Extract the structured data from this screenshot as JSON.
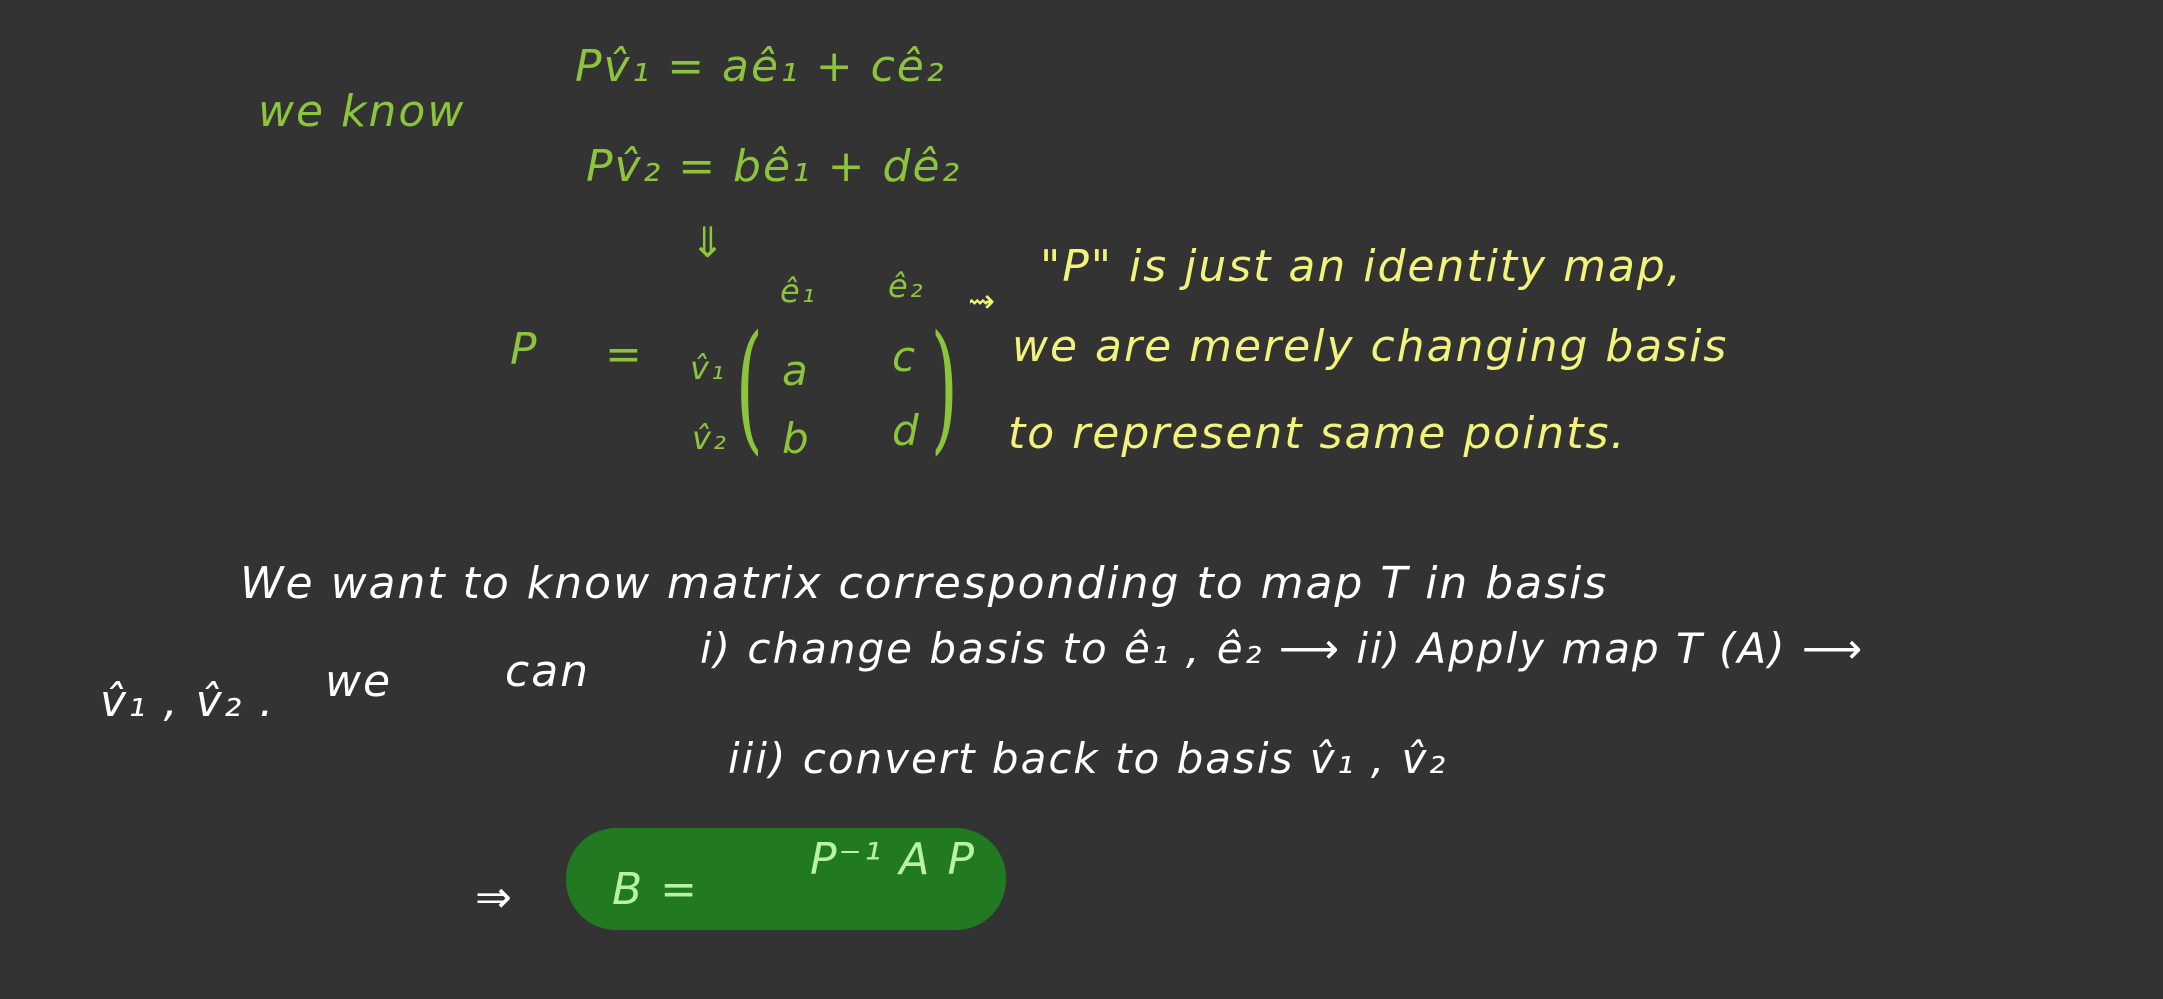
{
  "notes": {
    "known_heading": "we   know",
    "eq1": "Pv̂₁ = aê₁ + cê₂",
    "eq2": "Pv̂₂ = bê₁ + dê₂",
    "down_arrow": "⇓",
    "p_label": "P",
    "equals": "=",
    "col1": "ê₁",
    "col2": "ê₂",
    "row1": "v̂₁",
    "row2": "v̂₂",
    "m11": "a",
    "m12": "c",
    "m21": "b",
    "m22": "d",
    "implies_arrow": "⇝",
    "remark_line1": "\"P\" is just an identity map,",
    "remark_line2": "we are merely changing basis",
    "remark_line3": "to represent  same  points.",
    "line_a": "We want  to  know    matrix  corresponding   to    map T   in  basis",
    "line_b_start": "v̂₁ , v̂₂ .",
    "line_b_we": "we",
    "line_b_can": "can",
    "line_b_rest": "i) change  basis  to  ê₁ , ê₂  ⟶   ii)  Apply   map T (A)  ⟶",
    "line_c": "iii)  convert    back    to    basis  v̂₁ , v̂₂",
    "result_arrow": "⇒",
    "result_lhs": "B  =",
    "result_rhs": "P⁻¹ A P"
  },
  "colors": {
    "background": "#333333",
    "green_ink": "#8cc43c",
    "yellow_ink": "#f1f37a",
    "white_ink": "#ffffff",
    "highlight": "#217a22"
  }
}
